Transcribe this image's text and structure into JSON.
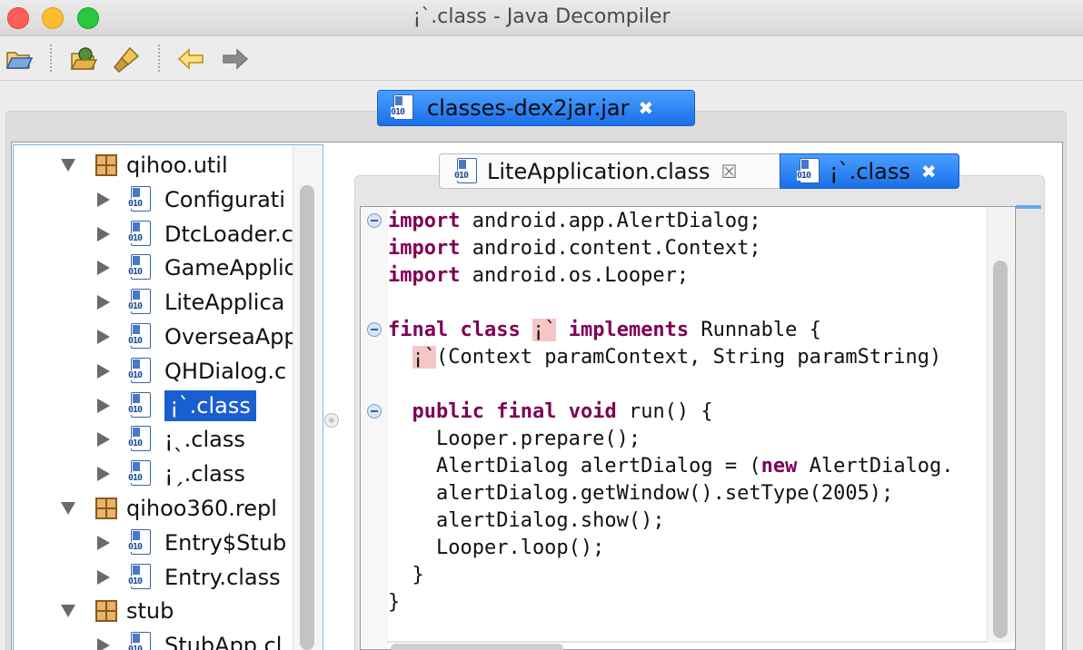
{
  "window": {
    "title": "¡`.class - Java Decompiler"
  },
  "toolbar": {
    "buttons": [
      "open-file",
      "open-type",
      "search",
      "back",
      "forward"
    ]
  },
  "jar_tab": {
    "label": "classes-dex2jar.jar",
    "close": "✖"
  },
  "tree": {
    "rows": [
      {
        "label": "qihoo.util",
        "kind": "package",
        "expanded": true
      },
      {
        "label": "Configurati",
        "kind": "class"
      },
      {
        "label": "DtcLoader.c",
        "kind": "class"
      },
      {
        "label": "GameApplic",
        "kind": "class"
      },
      {
        "label": "LiteApplica",
        "kind": "class"
      },
      {
        "label": "OverseaApp",
        "kind": "class"
      },
      {
        "label": "QHDialog.c",
        "kind": "class"
      },
      {
        "label": "¡`.class",
        "kind": "class",
        "selected": true
      },
      {
        "label": "¡ˎ.class",
        "kind": "class"
      },
      {
        "label": "¡ˏ.class",
        "kind": "class"
      },
      {
        "label": "qihoo360.repl",
        "kind": "package",
        "expanded": true
      },
      {
        "label": "Entry$Stub",
        "kind": "class"
      },
      {
        "label": "Entry.class",
        "kind": "class"
      },
      {
        "label": "stub",
        "kind": "package",
        "expanded": true
      },
      {
        "label": "StubApp.cl",
        "kind": "class"
      }
    ]
  },
  "editor_tabs": [
    {
      "label": "LiteApplication.class",
      "close": "☒",
      "active": false
    },
    {
      "label": "¡`.class",
      "close": "✖",
      "active": true
    }
  ],
  "code": {
    "lines": [
      [
        {
          "t": "import",
          "k": true
        },
        {
          "t": " android.app.AlertDialog;"
        }
      ],
      [
        {
          "t": "import",
          "k": true
        },
        {
          "t": " android.content.Context;"
        }
      ],
      [
        {
          "t": "import",
          "k": true
        },
        {
          "t": " android.os.Looper;"
        }
      ],
      [],
      [
        {
          "t": "final",
          "k": true
        },
        {
          "t": " "
        },
        {
          "t": "class",
          "k": true
        },
        {
          "t": " "
        },
        {
          "t": "¡`",
          "h": true
        },
        {
          "t": " "
        },
        {
          "t": "implements",
          "k": true
        },
        {
          "t": " Runnable {"
        }
      ],
      [
        {
          "t": "  "
        },
        {
          "t": "¡`",
          "h": true
        },
        {
          "t": "(Context paramContext, String paramString)"
        }
      ],
      [],
      [
        {
          "t": "  "
        },
        {
          "t": "public",
          "k": true
        },
        {
          "t": " "
        },
        {
          "t": "final",
          "k": true
        },
        {
          "t": " "
        },
        {
          "t": "void",
          "k": true
        },
        {
          "t": " run() {"
        }
      ],
      [
        {
          "t": "    Looper.prepare();"
        }
      ],
      [
        {
          "t": "    AlertDialog alertDialog = ("
        },
        {
          "t": "new",
          "k": true
        },
        {
          "t": " AlertDialog."
        }
      ],
      [
        {
          "t": "    alertDialog.getWindow().setType(2005);"
        }
      ],
      [
        {
          "t": "    alertDialog.show();"
        }
      ],
      [
        {
          "t": "    Looper.loop();"
        }
      ],
      [
        {
          "t": "  }"
        }
      ],
      [
        {
          "t": "}"
        }
      ]
    ],
    "fold_lines": [
      0,
      4,
      7
    ]
  }
}
